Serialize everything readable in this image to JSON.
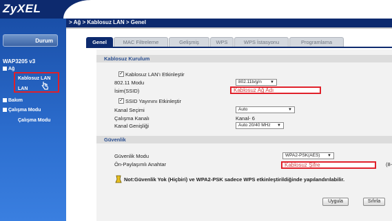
{
  "header": {
    "logo": "ZyXEL"
  },
  "breadcrumb": "> Ağ > Kablosuz LAN > Genel",
  "sidebar": {
    "status_button": "Durum",
    "device_name": "WAP3205 v3",
    "items": [
      {
        "label": "Ağ"
      },
      {
        "label": "Kablosuz LAN"
      },
      {
        "label": "LAN"
      },
      {
        "label": "Bakım"
      },
      {
        "label": "Çalışma Modu"
      },
      {
        "label": "Çalışma Modu"
      }
    ]
  },
  "tabs": [
    {
      "label": "Genel",
      "active": true
    },
    {
      "label": "MAC Filtreleme",
      "active": false
    },
    {
      "label": "Gelişmiş",
      "active": false
    },
    {
      "label": "WPS",
      "active": false
    },
    {
      "label": "WPS İstasyonu",
      "active": false
    },
    {
      "label": "Programlama",
      "active": false
    }
  ],
  "wireless": {
    "section_title": "Kablosuz Kurulum",
    "enable_label": "Kablosuz LAN'ı Etkinleştir",
    "enable_checked": true,
    "mode_label": "802.11 Modu",
    "mode_value": "802.11b/g/n",
    "ssid_label": "İsim(SSID)",
    "ssid_value": "Kablosuz Ağ Adı",
    "broadcast_label": "SSID Yayınını Etkinleştir",
    "broadcast_checked": true,
    "channel_select_label": "Kanal Seçimi",
    "channel_select_value": "Auto",
    "operating_channel_label": "Çalışma Kanalı",
    "operating_channel_value": "Kanal- 6",
    "channel_width_label": "Kanal Genişliği",
    "channel_width_value": "Auto 20/40 MHz"
  },
  "security": {
    "section_title": "Güvenlik",
    "mode_label": "Güvenlik Modu",
    "mode_value": "WPA2-PSK(AES)",
    "key_label": "Ön-Paylaşımlı Anahtar",
    "key_value": "Kablosuz Şifre",
    "key_hint": "(8-",
    "note": "Not:Güvenlik Yok (Hiçbiri) ve WPA2-PSK sadece WPS etkinleştirildiğinde yapılandırılabilir."
  },
  "actions": {
    "apply": "Uygula",
    "reset": "Sıfırla"
  },
  "colors": {
    "header": "#0d2a6e",
    "sidebar": "#2d6fd0",
    "highlight": "#e0202a"
  }
}
